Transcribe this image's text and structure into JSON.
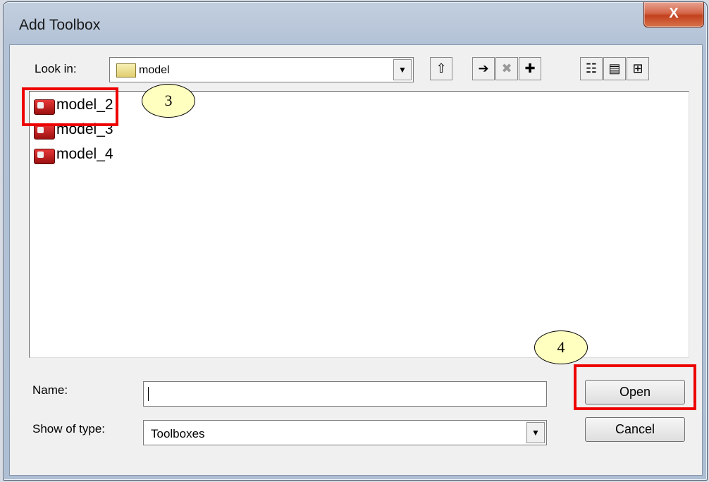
{
  "window": {
    "title": "Add Toolbox",
    "close_label": "X"
  },
  "lookin": {
    "label": "Look in:",
    "value": "model",
    "dropdown_glyph": "▼"
  },
  "toolbar": {
    "up_glyph": "⇧",
    "connect_glyph": "➔",
    "disconnect_glyph": "✖",
    "newfolder_glyph": "✚",
    "list_glyph": "☷",
    "details_glyph": "▤",
    "thumbs_glyph": "⊞"
  },
  "files": [
    {
      "name": "model_2",
      "icon": "toolbox-icon"
    },
    {
      "name": "model_3",
      "icon": "toolbox-icon"
    },
    {
      "name": "model_4",
      "icon": "toolbox-icon"
    }
  ],
  "annotations": {
    "step3": "3",
    "step4": "4",
    "highlight_color": "#ee0000",
    "callout_fill": "#ffffc0"
  },
  "form": {
    "name_label": "Name:",
    "name_value": "",
    "type_label": "Show of type:",
    "type_value": "Toolboxes",
    "dropdown_glyph": "▼"
  },
  "buttons": {
    "open": "Open",
    "cancel": "Cancel"
  }
}
